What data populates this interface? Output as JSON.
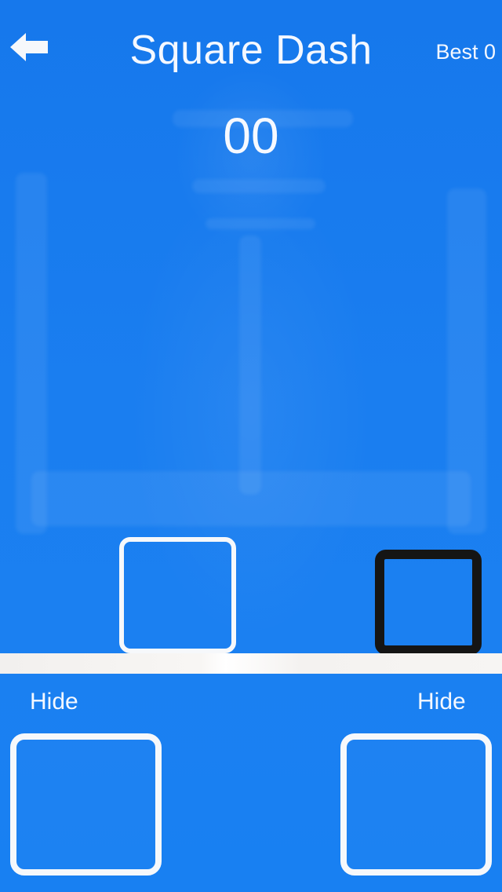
{
  "header": {
    "back_icon": "arrow-left-icon",
    "title": "Square Dash",
    "best": "Best 0"
  },
  "game": {
    "score": "00",
    "colors": {
      "background": "#1a7cf0",
      "player_outline": "#f6f8fb",
      "obstacle_outline": "#151515",
      "ground": "#f4f2f0"
    }
  },
  "controls": {
    "left_label": "Hide",
    "right_label": "Hide"
  }
}
